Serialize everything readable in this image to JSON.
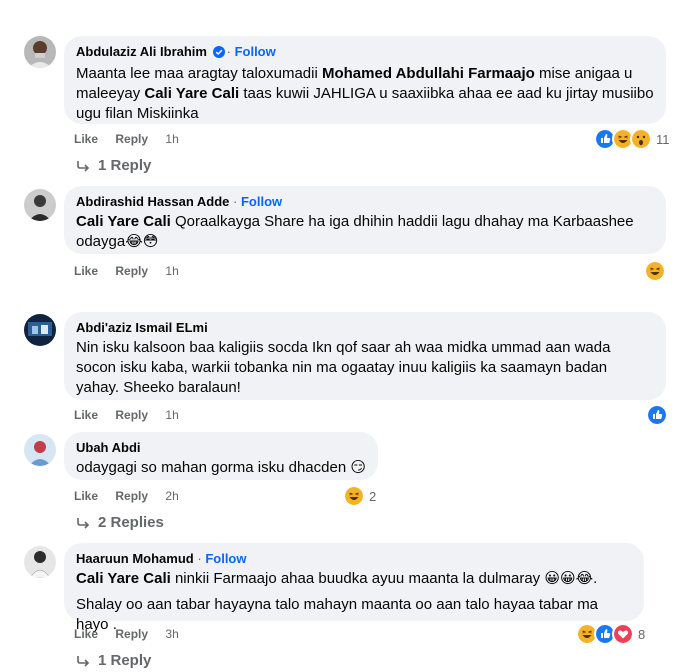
{
  "comments": [
    {
      "author": "Abdulaziz Ali Ibrahim",
      "follow": "Follow",
      "text_parts": [
        {
          "t": "Maanta lee maa aragtay taloxumadii "
        },
        {
          "b": "Mohamed Abdullahi Farmaajo"
        },
        {
          "t": " mise anigaa u maleeyay "
        },
        {
          "b": "Cali Yare Cali"
        },
        {
          "t": " taas kuwii JAHLIGA u saaxiibka ahaa ee aad ku jirtay musiibo ugu filan Miskiinka"
        }
      ],
      "like": "Like",
      "reply": "Reply",
      "time": "1h",
      "reaction_count": "11",
      "replies_label": "1 Reply"
    },
    {
      "author": "Abdirashid Hassan Adde",
      "follow": "Follow",
      "mention": "Cali Yare Cali",
      "text": " Qoraalkayga Share ha iga dhihin haddii lagu dhahay ma Karbaashee odayga😂😳",
      "like": "Like",
      "reply": "Reply",
      "time": "1h"
    },
    {
      "author": "Abdi'aziz Ismail ELmi",
      "text": "Nin isku kalsoon baa kaligiis socda Ikn qof saar ah waa midka ummad aan wada socon isku kaba, warkii tobanka nin ma ogaatay inuu kaligiis ka saamayn badan yahay. Sheeko baralaun!",
      "like": "Like",
      "reply": "Reply",
      "time": "1h"
    },
    {
      "author": "Ubah Abdi",
      "text": "odaygagi so mahan gorma isku dhacden 😏",
      "like": "Like",
      "reply": "Reply",
      "time": "2h",
      "reaction_count": "2",
      "replies_label": "2 Replies"
    },
    {
      "author": "Haaruun Mohamud",
      "follow": "Follow",
      "mention": "Cali Yare Cali",
      "text": " ninkii Farmaajo ahaa buudka ayuu maanta la dulmaray 😀😀😂.",
      "text2": "Shalay oo aan tabar hayayna talo mahayn maanta oo aan talo hayaa tabar ma hayo .",
      "like": "Like",
      "reply": "Reply",
      "time": "3h",
      "reaction_count": "8",
      "replies_label": "1 Reply"
    }
  ],
  "colors": {
    "bubble": "#f0f2f5",
    "follow": "#0866ff",
    "meta": "#65676b",
    "like_react": "#1877f2",
    "haha_react": "#f7b125",
    "love_react": "#f33e58"
  }
}
